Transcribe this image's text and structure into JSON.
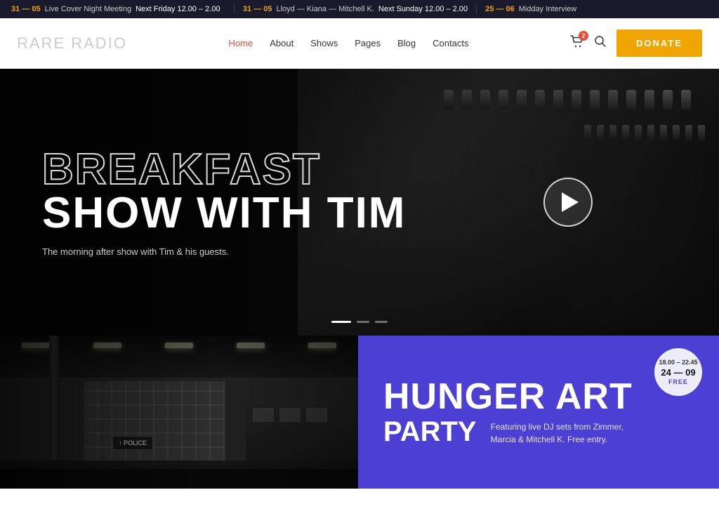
{
  "ticker": {
    "items": [
      {
        "date": "31 — 05",
        "text": "Live Cover Night Meeting",
        "time": "Next Friday 12.00 – 2.00"
      },
      {
        "date": "31 — 05",
        "text": "Lloyd — Kiana — Mitchell K.",
        "time": "Next Sunday 12.00 – 2.00"
      },
      {
        "date": "25 — 06",
        "text": "Midday Interview",
        "time": ""
      }
    ]
  },
  "header": {
    "logo_bold": "RARE",
    "logo_light": "RADIO",
    "nav": [
      {
        "label": "Home",
        "active": true
      },
      {
        "label": "About",
        "active": false
      },
      {
        "label": "Shows",
        "active": false
      },
      {
        "label": "Pages",
        "active": false
      },
      {
        "label": "Blog",
        "active": false
      },
      {
        "label": "Contacts",
        "active": false
      }
    ],
    "cart_count": "2",
    "donate_label": "DONATE"
  },
  "hero": {
    "title_outline": "BREAKFAST",
    "title_solid": "SHOW WITH TIM",
    "subtitle": "The morning after show with Tim & his guests.",
    "dots": 3
  },
  "bottom": {
    "subway_sign_text": "↑ POLICE",
    "event_title": "HUNGER ART",
    "event_party": "PARTY",
    "event_desc": "Featuring live DJ sets from Zimmer, Marcia & Mitchell K. Free entry.",
    "badge": {
      "time": "18.00 – 22.45",
      "date": "24 — 09",
      "free": "FREE"
    }
  }
}
